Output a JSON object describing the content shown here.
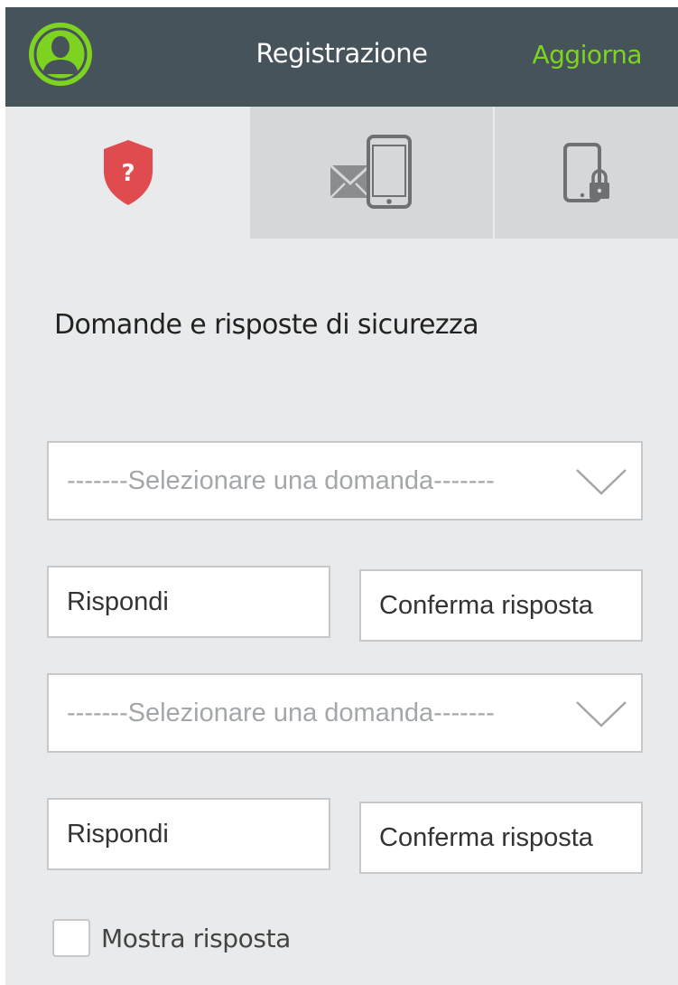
{
  "header": {
    "title": "Registrazione",
    "action_label": "Aggiorna",
    "avatar_icon": "user-avatar-icon"
  },
  "tabs": [
    {
      "icon": "security-question-shield-icon",
      "active": true
    },
    {
      "icon": "email-phone-icon",
      "active": false
    },
    {
      "icon": "phone-lock-icon",
      "active": false
    }
  ],
  "section_title": "Domande e risposte di sicurezza",
  "questions": [
    {
      "select_placeholder": "-------Selezionare una domanda-------",
      "answer_placeholder": "Rispondi",
      "confirm_placeholder": "Conferma risposta"
    },
    {
      "select_placeholder": "-------Selezionare una domanda-------",
      "answer_placeholder": "Rispondi",
      "confirm_placeholder": "Conferma risposta"
    }
  ],
  "show_answer": {
    "label": "Mostra risposta",
    "checked": false
  },
  "colors": {
    "header_bg": "#47535b",
    "accent_green": "#7ed321",
    "shield_red": "#e04b4f",
    "page_bg": "#e8eaeb",
    "inactive_tab_bg": "#d6d7d8"
  }
}
